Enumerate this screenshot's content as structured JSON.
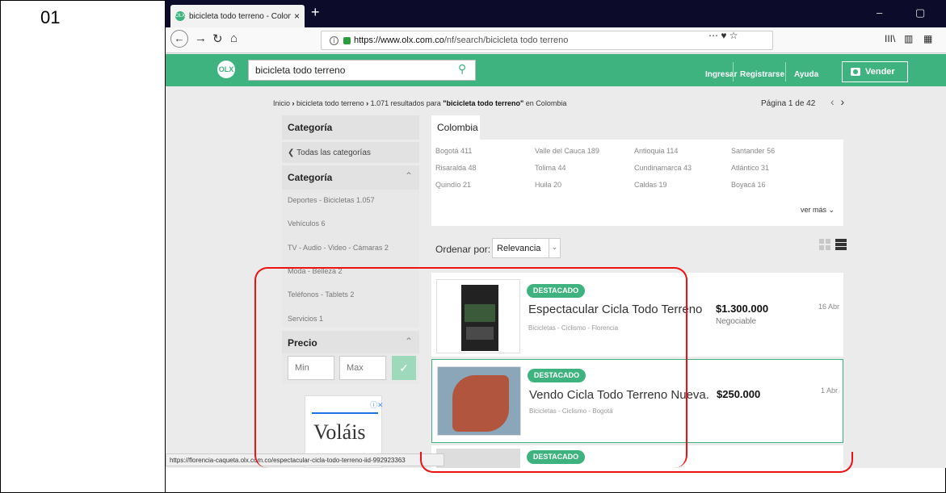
{
  "row_number": "01",
  "browser": {
    "tab_title": "bicicleta todo terreno - Colom",
    "tab_close": "×",
    "new_tab": "+",
    "favicon_text": "OLX",
    "url_host": "https://www.olx.com.co",
    "url_path": "/nf/search/bicicleta todo terreno",
    "url_actions": "⋯ ♥ ☆",
    "window_controls": [
      "–",
      "▢"
    ],
    "right_icons": [
      "III\\",
      "▥",
      "▦"
    ],
    "status_url": "https://florencia-caqueta.olx.com.co/espectacular-cicla-todo-terreno-iid-992923363"
  },
  "header": {
    "logo": "OLX",
    "search_value": "bicicleta todo terreno",
    "links": [
      "Ingresar",
      "Registrarse",
      "Ayuda"
    ],
    "sell_label": "Vender"
  },
  "breadcrumb": {
    "home": "Inicio",
    "sep": "›",
    "query": "bicicleta todo terreno",
    "results_pre": "1.071 resultados para",
    "results_term": "\"bicicleta todo terreno\"",
    "results_post": "en Colombia"
  },
  "pager": {
    "label": "Página 1 de 42",
    "prev": "‹",
    "next": "›"
  },
  "sidebar": {
    "category_title": "Categoría",
    "all_categories": "Todas las categorías",
    "category_title2": "Categoría",
    "items": [
      {
        "label": "Deportes - Bicicletas",
        "count": "1.057"
      },
      {
        "label": "Vehículos",
        "count": "6"
      },
      {
        "label": "TV - Audio - Video - Cámaras",
        "count": "2"
      },
      {
        "label": "Moda - Belleza",
        "count": "2"
      },
      {
        "label": "Teléfonos - Tablets",
        "count": "2"
      },
      {
        "label": "Servicios",
        "count": "1"
      }
    ],
    "price_title": "Precio",
    "min_placeholder": "Min",
    "max_placeholder": "Max",
    "ad_text": "Voláis"
  },
  "location": {
    "tab": "Colombia",
    "cities": [
      {
        "name": "Bogotá",
        "count": "411"
      },
      {
        "name": "Valle del Cauca",
        "count": "189"
      },
      {
        "name": "Antioquia",
        "count": "114"
      },
      {
        "name": "Santander",
        "count": "56"
      },
      {
        "name": "Risaralda",
        "count": "48"
      },
      {
        "name": "Tolima",
        "count": "44"
      },
      {
        "name": "Cundinamarca",
        "count": "43"
      },
      {
        "name": "Atlántico",
        "count": "31"
      },
      {
        "name": "Quindío",
        "count": "21"
      },
      {
        "name": "Huila",
        "count": "20"
      },
      {
        "name": "Caldas",
        "count": "19"
      },
      {
        "name": "Boyacá",
        "count": "16"
      }
    ],
    "ver_mas": "ver más"
  },
  "sort": {
    "label": "Ordenar por:",
    "value": "Relevancia"
  },
  "listings": [
    {
      "badge": "DESTACADO",
      "title": "Espectacular Cicla Todo Terreno",
      "subtitle": "Bicicletas - Ciclismo - Florencia",
      "price": "$1.300.000",
      "note": "Negociable",
      "date": "16 Abr"
    },
    {
      "badge": "DESTACADO",
      "title": "Vendo Cicla Todo Terreno Nueva.",
      "subtitle": "Bicicletas - Ciclismo - Bogotá",
      "price": "$250.000",
      "note": "",
      "date": "1 Abr"
    },
    {
      "badge": "DESTACADO"
    }
  ],
  "colors": {
    "brand": "#3eb37f",
    "highlight": "#ee1111"
  }
}
